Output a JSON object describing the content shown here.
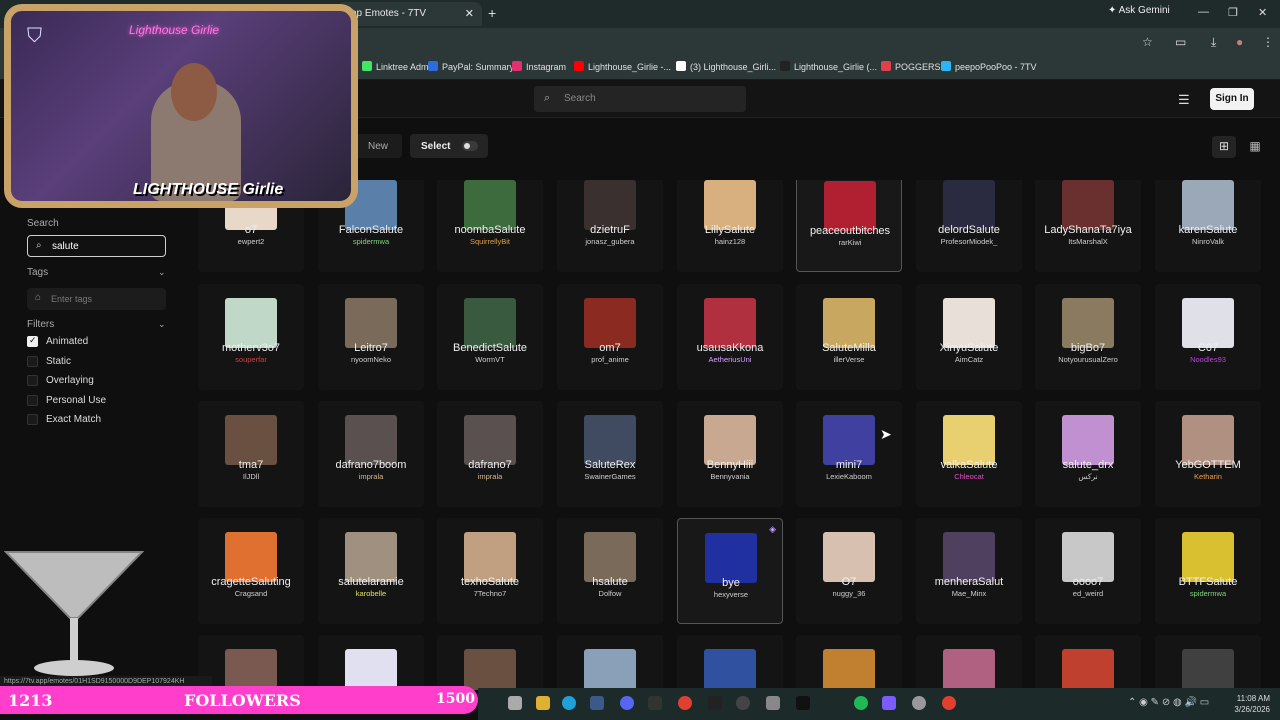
{
  "browser": {
    "tab_title": "Top Emotes - 7TV",
    "tab_close": "✕",
    "new_tab": "+",
    "ask_gemini": "Ask Gemini",
    "window_min": "—",
    "window_max": "❐",
    "window_close": "✕"
  },
  "bookmarks": [
    {
      "label": "Linktree Admin",
      "color": "#43e660"
    },
    {
      "label": "PayPal: Summary",
      "color": "#2d6cdf"
    },
    {
      "label": "Instagram",
      "color": "#e1306c"
    },
    {
      "label": "Lighthouse_Girlie -...",
      "color": "#ff0000"
    },
    {
      "label": "(3) Lighthouse_Girli...",
      "color": "#ffffff"
    },
    {
      "label": "Lighthouse_Girlie (...",
      "color": "#222222"
    },
    {
      "label": "POGGERS",
      "color": "#e0404a"
    },
    {
      "label": "peepoPooPoo - 7TV",
      "color": "#29b6f6"
    }
  ],
  "header": {
    "search_placeholder": "Search",
    "sign_in": "Sign In"
  },
  "toolbar": {
    "new_label": "New",
    "select_label": "Select"
  },
  "sidebar": {
    "search_label": "Search",
    "search_value": "salute",
    "tags_label": "Tags",
    "tags_placeholder": "Enter tags",
    "filters_label": "Filters",
    "filters": [
      {
        "label": "Animated",
        "checked": true
      },
      {
        "label": "Static",
        "checked": false
      },
      {
        "label": "Overlaying",
        "checked": false
      },
      {
        "label": "Personal Use",
        "checked": false
      },
      {
        "label": "Exact Match",
        "checked": false
      }
    ]
  },
  "emotes": [
    [
      {
        "name": "o7",
        "author": "ewpert2",
        "author_color": "#cfcfcf",
        "img": "#e8d8c8"
      },
      {
        "name": "FalconSalute",
        "author": "spidermwa",
        "author_color": "#7dd87d",
        "img": "#5a7fa8"
      },
      {
        "name": "noombaSalute",
        "author": "SquirrellyBit",
        "author_color": "#e0a040",
        "img": "#3d6b3d"
      },
      {
        "name": "dzietruF",
        "author": "jonasz_gubera",
        "author_color": "#cfcfcf",
        "img": "#3a3030"
      },
      {
        "name": "LillySalute",
        "author": "hainz128",
        "author_color": "#cfcfcf",
        "img": "#d8b080"
      },
      {
        "name": "peaceoutbitches",
        "author": "rarKiwi",
        "author_color": "#cfcfcf",
        "img": "#b02030"
      },
      {
        "name": "delordSalute",
        "author": "ProfesorMiodek_",
        "author_color": "#cfcfcf",
        "img": "#2a2a40"
      },
      {
        "name": "LadyShanaTa7iya",
        "author": "ItsMarshalX",
        "author_color": "#cfcfcf",
        "img": "#6a3030"
      },
      {
        "name": "karenSalute",
        "author": "NinroValk",
        "author_color": "#cfcfcf",
        "img": "#9aa8b8"
      }
    ],
    [
      {
        "name": "motherv3o7",
        "author": "souperfar",
        "author_color": "#d04040",
        "img": "#c0d8c8"
      },
      {
        "name": "Leitro7",
        "author": "nyoomNeko",
        "author_color": "#cfcfcf",
        "img": "#7a6a5a"
      },
      {
        "name": "BenedictSalute",
        "author": "WormVT",
        "author_color": "#cfcfcf",
        "img": "#3a5a40"
      },
      {
        "name": "om7",
        "author": "prof_anime",
        "author_color": "#cfcfcf",
        "img": "#8a2a20"
      },
      {
        "name": "usausaKkona",
        "author": "AetheriusUni",
        "author_color": "#d8a0ff",
        "img": "#b03040"
      },
      {
        "name": "SaluteMilla",
        "author": "illerVerse",
        "author_color": "#cfcfcf",
        "img": "#c8a860"
      },
      {
        "name": "XinyuSalute",
        "author": "AimCatz",
        "author_color": "#cfcfcf",
        "img": "#e8e0d8"
      },
      {
        "name": "bigBo7",
        "author": "NotyourusualZero",
        "author_color": "#cfcfcf",
        "img": "#8a7a60"
      },
      {
        "name": "C07",
        "author": "Noodles93",
        "author_color": "#c040e0",
        "img": "#e0e0e8"
      }
    ],
    [
      {
        "name": "tma7",
        "author": "IlJDll",
        "author_color": "#cfcfcf",
        "img": "#6a5040"
      },
      {
        "name": "dafrano7boom",
        "author": "imprala",
        "author_color": "#d8b890",
        "img": "#5a5050"
      },
      {
        "name": "dafrano7",
        "author": "imprala",
        "author_color": "#d8b890",
        "img": "#5a5050"
      },
      {
        "name": "SaluteRex",
        "author": "SwainerGames",
        "author_color": "#cfcfcf",
        "img": "#404a60"
      },
      {
        "name": "BennyHiii",
        "author": "Bennyvania",
        "author_color": "#cfcfcf",
        "img": "#c8a890"
      },
      {
        "name": "mini7",
        "author": "LexieKaboom",
        "author_color": "#cfcfcf",
        "img": "#4040a0"
      },
      {
        "name": "valkaSalute",
        "author": "Chleocat",
        "author_color": "#e050c0",
        "img": "#e8d070"
      },
      {
        "name": "salute_drx",
        "author": "نركس",
        "author_color": "#cfcfcf",
        "img": "#c090d0"
      },
      {
        "name": "YebGOTTEM",
        "author": "Ketharin",
        "author_color": "#e8a050",
        "img": "#b09080"
      }
    ],
    [
      {
        "name": "cragetteSaluting",
        "author": "Cragsand",
        "author_color": "#cfcfcf",
        "img": "#e07030"
      },
      {
        "name": "salutelaramie",
        "author": "karobelle",
        "author_color": "#e0e060",
        "img": "#a09080"
      },
      {
        "name": "texhoSalute",
        "author": "7Techno7",
        "author_color": "#cfcfcf",
        "img": "#c0a080"
      },
      {
        "name": "hsalute",
        "author": "Dolfow",
        "author_color": "#cfcfcf",
        "img": "#7a6a5a"
      },
      {
        "name": "bye",
        "author": "hexyverse",
        "author_color": "#cfcfcf",
        "img": "#2030a0"
      },
      {
        "name": "O7",
        "author": "nuggy_36",
        "author_color": "#cfcfcf",
        "img": "#d8c0b0"
      },
      {
        "name": "menheraSalut",
        "author": "Mae_Minx",
        "author_color": "#cfcfcf",
        "img": "#504060"
      },
      {
        "name": "oooo7",
        "author": "ed_weird",
        "author_color": "#cfcfcf",
        "img": "#c8c8c8"
      },
      {
        "name": "BTTFSalute",
        "author": "spidermwa",
        "author_color": "#7dd87d",
        "img": "#d8c030"
      }
    ]
  ],
  "overlay": {
    "neon_sign": "Lighthouse Girlie",
    "brand": "LIGHTHOUSE Girlie",
    "followers_count": "1213",
    "followers_label": "FOLLOWERS",
    "followers_goal": "1500",
    "status_url": "https://7tv.app/emotes/01H1SD9150000D9DEP107924KH"
  },
  "taskbar": {
    "clock_time": "11:08 AM",
    "clock_date": "3/26/2026"
  }
}
